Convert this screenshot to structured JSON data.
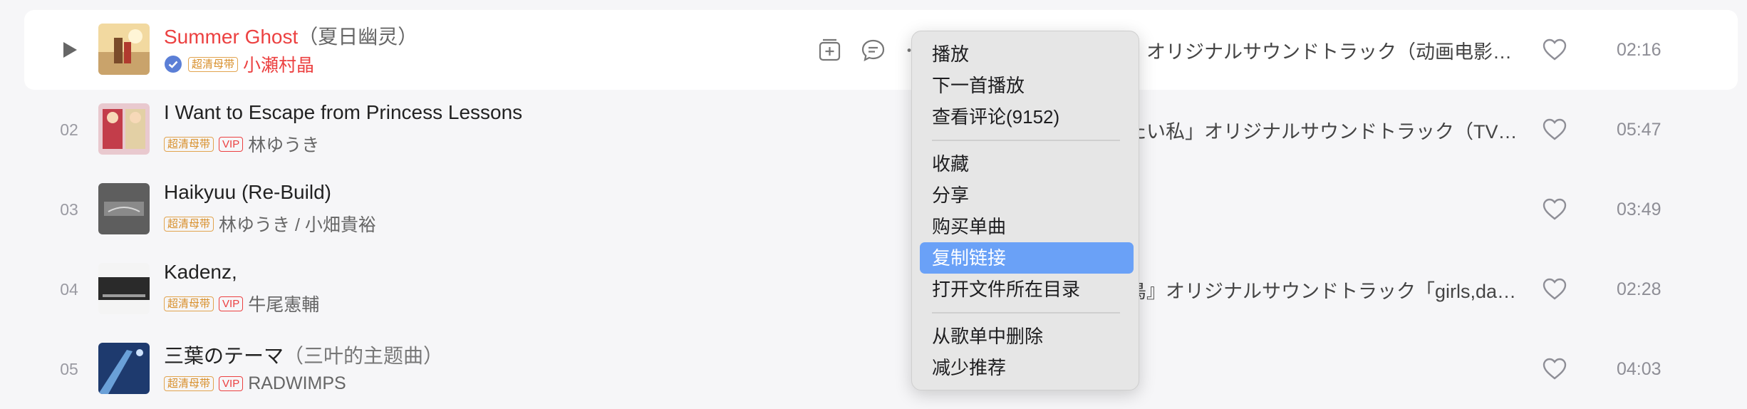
{
  "songs": [
    {
      "num": "",
      "title": "Summer Ghost",
      "title_sub": "（夏日幽灵）",
      "badges": [
        "超清母带"
      ],
      "vip": false,
      "verified": true,
      "artist": "小瀬村晶",
      "album": "』オリジナルサウンドトラック（动画电影…",
      "duration": "02:16"
    },
    {
      "num": "02",
      "title": "I Want to Escape from Princess Lessons",
      "title_sub": "",
      "badges": [
        "超清母带"
      ],
      "vip": true,
      "vip_label": "VIP",
      "verified": false,
      "artist": "林ゆうき",
      "album": "たい私」オリジナルサウンドトラック（TV…",
      "duration": "05:47"
    },
    {
      "num": "03",
      "title": "Haikyuu (Re-Build)",
      "title_sub": "",
      "badges": [
        "超清母带"
      ],
      "vip": false,
      "verified": false,
      "artist": "林ゆうき / 小畑貴裕",
      "album": "",
      "duration": "03:49"
    },
    {
      "num": "04",
      "title": "Kadenz,",
      "title_sub": "",
      "badges": [
        "超清母带"
      ],
      "vip": true,
      "vip_label": "VIP",
      "verified": false,
      "artist": "牛尾憲輔",
      "album": "鳥』オリジナルサウンドトラック「girls,da…",
      "duration": "02:28"
    },
    {
      "num": "05",
      "title": "三葉のテーマ",
      "title_sub": "（三叶的主题曲）",
      "badges": [
        "超清母带"
      ],
      "vip": true,
      "vip_label": "VIP",
      "verified": false,
      "artist": "RADWIMPS",
      "album": "",
      "duration": "04:03"
    }
  ],
  "menu": {
    "play": "播放",
    "play_next": "下一首播放",
    "view_comments": "查看评论(9152)",
    "collect": "收藏",
    "share": "分享",
    "buy": "购买单曲",
    "copy_link": "复制链接",
    "open_folder": "打开文件所在目录",
    "remove": "从歌单中删除",
    "recommend_less": "减少推荐"
  },
  "colors": {
    "accent": "#ec4141",
    "highlight": "#6aa1f7",
    "badge": "#d88f2a"
  }
}
